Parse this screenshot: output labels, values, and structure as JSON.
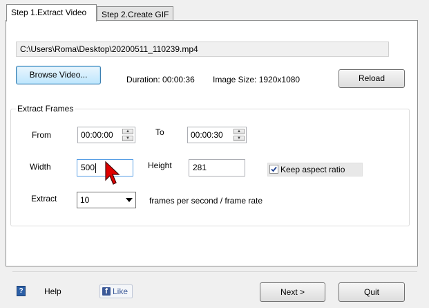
{
  "tabs": [
    {
      "label": "Step 1.Extract Video",
      "active": true
    },
    {
      "label": "Step 2.Create GIF",
      "active": false
    }
  ],
  "video": {
    "path": "C:\\Users\\Roma\\Desktop\\20200511_110239.mp4",
    "browse_label": "Browse Video...",
    "duration_text": "Duration: 00:00:36",
    "image_size_text": "Image Size: 1920x1080",
    "reload_label": "Reload"
  },
  "extract": {
    "group_title": "Extract Frames",
    "from_label": "From",
    "from_value": "00:00:00",
    "to_label": "To",
    "to_value": "00:00:30",
    "width_label": "Width",
    "width_value": "500",
    "height_label": "Height",
    "height_value": "281",
    "keep_aspect_label": "Keep aspect ratio",
    "keep_aspect_checked": true,
    "extract_label": "Extract",
    "extract_value": "10",
    "fps_label": "frames per second / frame rate"
  },
  "footer": {
    "help_label": "Help",
    "like_label": "Like",
    "next_label": "Next >",
    "quit_label": "Quit"
  },
  "colors": {
    "accent": "#3c7fb1",
    "facebook": "#3b5998",
    "cursor": "#e00000"
  }
}
